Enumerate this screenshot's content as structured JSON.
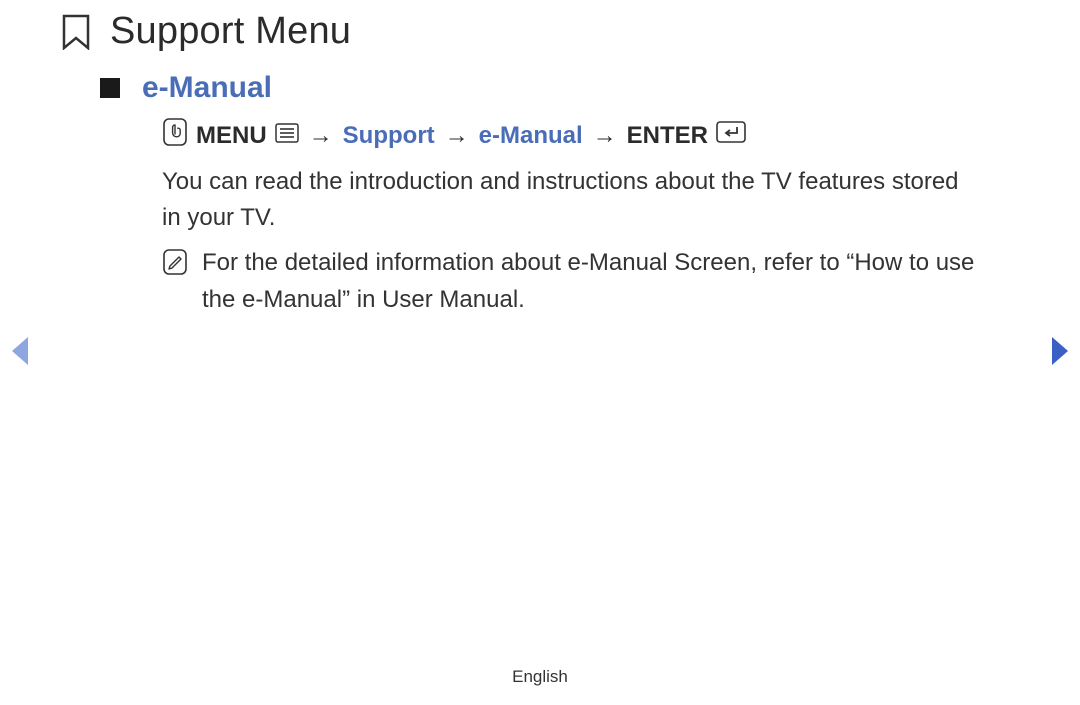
{
  "title": "Support Menu",
  "section": "e-Manual",
  "path": {
    "menu_label": "MENU",
    "arrow": "→",
    "step1": "Support",
    "step2": "e-Manual",
    "enter_label": "ENTER"
  },
  "body": "You can read the introduction and instructions about the TV features stored in your TV.",
  "note": "For the detailed information about e-Manual Screen, refer to “How to use the e-Manual” in User Manual.",
  "footer": "English"
}
